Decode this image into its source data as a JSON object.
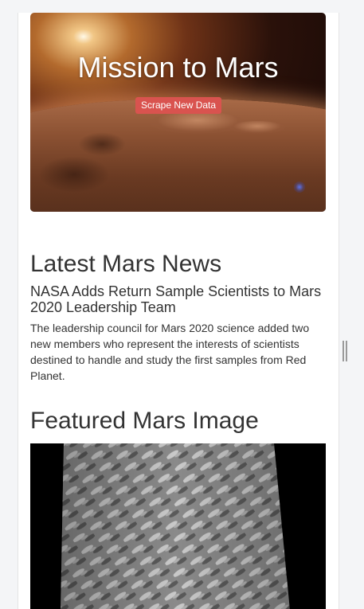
{
  "jumbotron": {
    "title": "Mission to Mars",
    "scrape_button_label": "Scrape New Data"
  },
  "news": {
    "section_heading": "Latest Mars News",
    "headline": "NASA Adds Return Sample Scientists to Mars 2020 Leadership Team",
    "teaser": "The leadership council for Mars 2020 science added two new members who represent the interests of scientists destined to handle and study the first samples from Red Planet."
  },
  "featured": {
    "section_heading": "Featured Mars Image"
  },
  "icons": {
    "scroll_handle": "drag-handle-icon"
  },
  "colors": {
    "button_danger": "#d9534f",
    "text": "#333333",
    "image_background": "#000000"
  }
}
